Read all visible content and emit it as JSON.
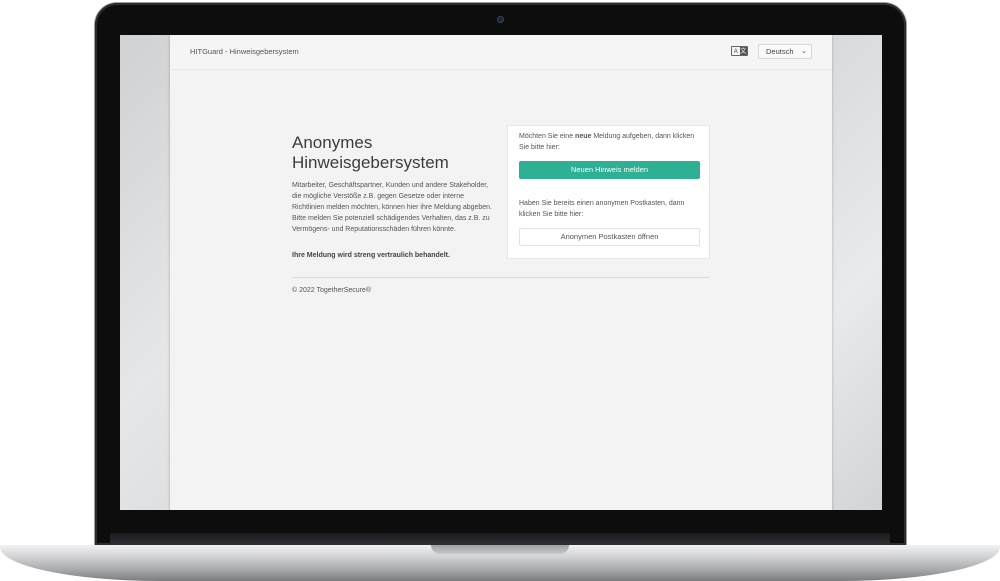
{
  "header": {
    "brand": "HITGuard - Hinweisgebersystem",
    "language_icon": {
      "left": "A",
      "right": "文",
      "icon": "translate-icon"
    },
    "language_select": {
      "value": "Deutsch",
      "icon": "chevron-down-icon"
    }
  },
  "intro": {
    "title": "Anonymes Hinweisgebersystem",
    "description": "Mitarbeiter, Geschäftspartner, Kunden und andere Stakeholder, die mögliche Verstöße z.B. gegen Gesetze oder interne Richtlinien melden möchten, können hier ihre Meldung abgeben. Bitte melden Sie potenziell schädigendes Verhalten, das z.B. zu Vermögens- und Reputationsschäden führen könnte.",
    "confidential": "Ihre Meldung wird streng vertraulich behandelt."
  },
  "card": {
    "new_prefix": "Möchten Sie eine ",
    "new_bold": "neue",
    "new_suffix": " Meldung aufgeben, dann klicken Sie bitte hier:",
    "new_button": "Neuen Hinweis melden",
    "existing_text": "Haben Sie bereits einen anonymen Postkasten, dann klicken Sie bitte hier:",
    "existing_button": "Anonymen Postkasten öffnen"
  },
  "footer": {
    "copyright": "© 2022 TogetherSecure®"
  },
  "colors": {
    "primary": "#2db093",
    "page_background": "#f3f3f3",
    "card_background": "#ffffff"
  }
}
